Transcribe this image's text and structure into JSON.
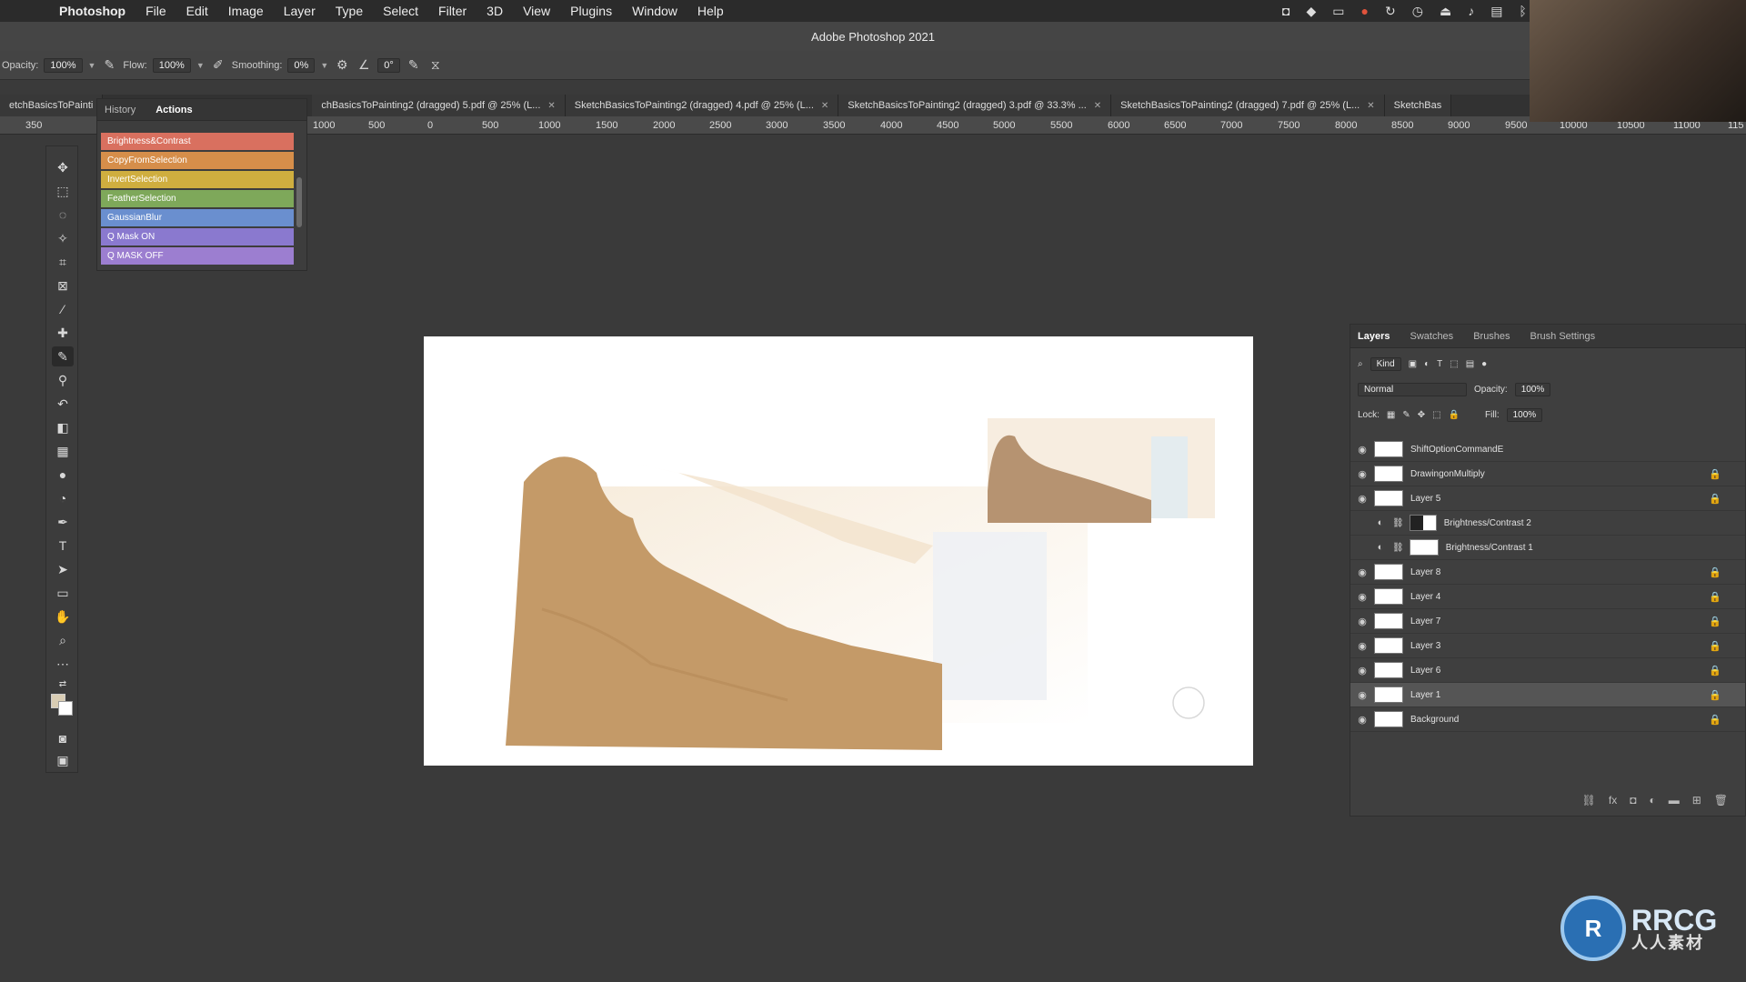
{
  "menubar": {
    "items": [
      "Photoshop",
      "File",
      "Edit",
      "Image",
      "Layer",
      "Type",
      "Select",
      "Filter",
      "3D",
      "View",
      "Plugins",
      "Window",
      "Help"
    ]
  },
  "window": {
    "title": "Adobe Photoshop 2021"
  },
  "options": {
    "opacity_label": "Opacity:",
    "opacity_value": "100%",
    "flow_label": "Flow:",
    "flow_value": "100%",
    "smoothing_label": "Smoothing:",
    "smoothing_value": "0%",
    "angle_value": "0°"
  },
  "tabs": [
    "etchBasicsToPainti",
    "chBasicsToPainting2 (dragged) 5.pdf @ 25% (L...",
    "SketchBasicsToPainting2 (dragged) 4.pdf @ 25% (L...",
    "SketchBasicsToPainting2 (dragged) 3.pdf @ 33.3% ...",
    "SketchBasicsToPainting2 (dragged) 7.pdf @ 25% (L...",
    "SketchBas"
  ],
  "ruler": [
    "350",
    "1000",
    "500",
    "0",
    "500",
    "1000",
    "1500",
    "2000",
    "2500",
    "3000",
    "3500",
    "4000",
    "4500",
    "5000",
    "5500",
    "6000",
    "6500",
    "7000",
    "7500",
    "8000",
    "8500",
    "9000",
    "9500",
    "10000",
    "10500",
    "11000",
    "115"
  ],
  "actions_panel": {
    "tab_history": "History",
    "tab_actions": "Actions",
    "items": [
      {
        "label": "Brightness&Contrast",
        "color": "#d9705f"
      },
      {
        "label": "CopyFromSelection",
        "color": "#d68e4a"
      },
      {
        "label": "InvertSelection",
        "color": "#cfae3f"
      },
      {
        "label": "FeatherSelection",
        "color": "#7ea85a"
      },
      {
        "label": "GaussianBlur",
        "color": "#6a8fcf"
      },
      {
        "label": "Q Mask ON",
        "color": "#8a79cf"
      },
      {
        "label": "Q MASK OFF",
        "color": "#9c7ed0"
      }
    ]
  },
  "layers_panel": {
    "tabs": [
      "Layers",
      "Swatches",
      "Brushes",
      "Brush Settings"
    ],
    "filter_label": "Kind",
    "blend_mode": "Normal",
    "opacity_label": "Opacity:",
    "opacity_value": "100%",
    "lock_label": "Lock:",
    "fill_label": "Fill:",
    "fill_value": "100%",
    "layers": [
      {
        "name": "ShiftOptionCommandE",
        "type": "layer",
        "locked": false,
        "selected": false
      },
      {
        "name": "DrawingonMultiply",
        "type": "layer",
        "locked": true,
        "selected": false
      },
      {
        "name": "Layer 5",
        "type": "layer",
        "locked": true,
        "selected": false
      },
      {
        "name": "Brightness/Contrast 2",
        "type": "adjustment",
        "locked": false,
        "selected": false
      },
      {
        "name": "Brightness/Contrast 1",
        "type": "adjustment",
        "locked": false,
        "selected": false
      },
      {
        "name": "Layer 8",
        "type": "layer",
        "locked": true,
        "selected": false
      },
      {
        "name": "Layer 4",
        "type": "layer",
        "locked": true,
        "selected": false
      },
      {
        "name": "Layer 7",
        "type": "layer",
        "locked": true,
        "selected": false
      },
      {
        "name": "Layer 3",
        "type": "layer",
        "locked": true,
        "selected": false
      },
      {
        "name": "Layer 6",
        "type": "layer",
        "locked": true,
        "selected": false
      },
      {
        "name": "Layer 1",
        "type": "layer",
        "locked": true,
        "selected": true
      },
      {
        "name": "Background",
        "type": "layer",
        "locked": true,
        "selected": false
      }
    ]
  },
  "watermark": {
    "big": "RRCG",
    "small": "人人素材"
  }
}
